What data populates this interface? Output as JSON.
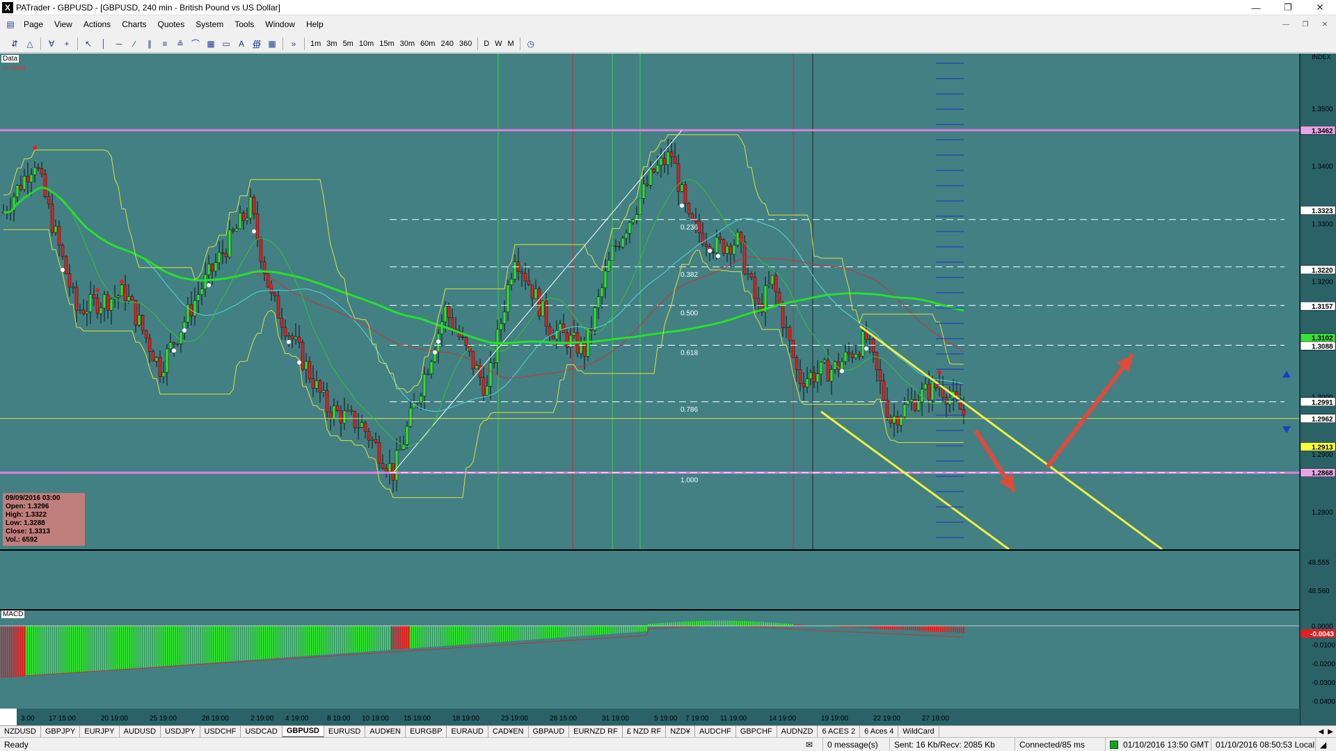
{
  "window": {
    "title": "PATrader - GBPUSD - [GBPUSD, 240 min - British Pound vs US Dollar]",
    "app_icon": "X"
  },
  "menu": [
    "Page",
    "View",
    "Actions",
    "Charts",
    "Quotes",
    "System",
    "Tools",
    "Window",
    "Help"
  ],
  "toolbar": {
    "timeframes": [
      "1m",
      "3m",
      "5m",
      "10m",
      "15m",
      "30m",
      "60m",
      "240",
      "360"
    ],
    "periods": [
      "D",
      "W",
      "M"
    ],
    "overflow": "»"
  },
  "chart": {
    "data_label": "Data",
    "locked_label": "Locked",
    "index_label": "INDEX",
    "macd_label": "MACD",
    "info": {
      "date": "09/09/2016 03:00",
      "open": "Open: 1.3296",
      "high": "High: 1.3322",
      "low": "Low: 1.3288",
      "close": "Close: 1.3313",
      "vol": "Vol.: 6592"
    },
    "fib_levels": [
      {
        "label": "0.236",
        "price": 1.3307
      },
      {
        "label": "0.382",
        "price": 1.3225
      },
      {
        "label": "0.500",
        "price": 1.3158
      },
      {
        "label": "0.618",
        "price": 1.3089
      },
      {
        "label": "0.786",
        "price": 1.2991
      },
      {
        "label": "1.000",
        "price": 1.2868
      }
    ],
    "price_ticks": [
      "1.3500",
      "1.3400",
      "1.3300",
      "1.3200",
      "1.3100",
      "1.3000",
      "1.2900",
      "1.2800"
    ],
    "price_tags": [
      {
        "text": "1.3462",
        "bg": "#e6a6e6"
      },
      {
        "text": "1.3323",
        "bg": "#ffffff"
      },
      {
        "text": "1.3220",
        "bg": "#ffffff"
      },
      {
        "text": "1.3157",
        "bg": "#ffffff"
      },
      {
        "text": "1.3102",
        "bg": "#38e038"
      },
      {
        "text": "1.3088",
        "bg": "#ffffff"
      },
      {
        "text": "1.2991",
        "bg": "#ffffff"
      },
      {
        "text": "1.2962",
        "bg": "#ffffff"
      },
      {
        "text": "1.2913",
        "bg": "#ffff40"
      },
      {
        "text": "1.2868",
        "bg": "#e6a6e6"
      }
    ],
    "osc_ticks": [
      "48.555",
      "48.560"
    ],
    "macd_ticks": [
      "0.0000",
      "-0.0100",
      "-0.0200",
      "-0.0300",
      "-0.0400"
    ],
    "macd_tags": [
      {
        "text": "-0.0043",
        "bg": "#e02020"
      }
    ],
    "time_labels": [
      "3:00",
      "17 15:00",
      "20 19:00",
      "25 19:00",
      "28 19:00",
      "2 19:00",
      "4 19:00",
      "8 19:00",
      "10 19:00",
      "15 19:00",
      "18 19:00",
      "23 19:00",
      "28 15:00",
      "31 19:00",
      "5 19:00",
      "7 19:00",
      "11 19:00",
      "14 19:00",
      "19 19:00",
      "22 19:00",
      "27 19:00"
    ],
    "colors": {
      "background": "#428083",
      "up": "#30e030",
      "down": "#e02020",
      "fib": "#ffffff",
      "channel": "#ffff40",
      "magenta": "#e080e0",
      "arrow": "#e04a3c"
    }
  },
  "tabs": [
    "NZDUSD",
    "GBPJPY",
    "EURJPY",
    "AUDUSD",
    "USDJPY",
    "USDCHF",
    "USDCAD",
    "GBPUSD",
    "EURUSD",
    "AUD¥EN",
    "EURGBP",
    "EURAUD",
    "CAD¥EN",
    "GBPAUD",
    "EURNZD RF",
    "£ NZD RF",
    "NZD¥",
    "AUDCHF",
    "GBPCHF",
    "AUDNZD",
    "6 ACES 2",
    "6 Aces 4",
    "WildCard"
  ],
  "active_tab": "GBPUSD",
  "status": {
    "ready": "Ready",
    "messages": "0 message(s)",
    "traffic": "Sent: 16 Kb/Recv: 2085 Kb",
    "connected": "Connected/85 ms",
    "gmt_time": "01/10/2016 13:50 GMT",
    "local_time": "01/10/2016 08:50:53 Local"
  }
}
